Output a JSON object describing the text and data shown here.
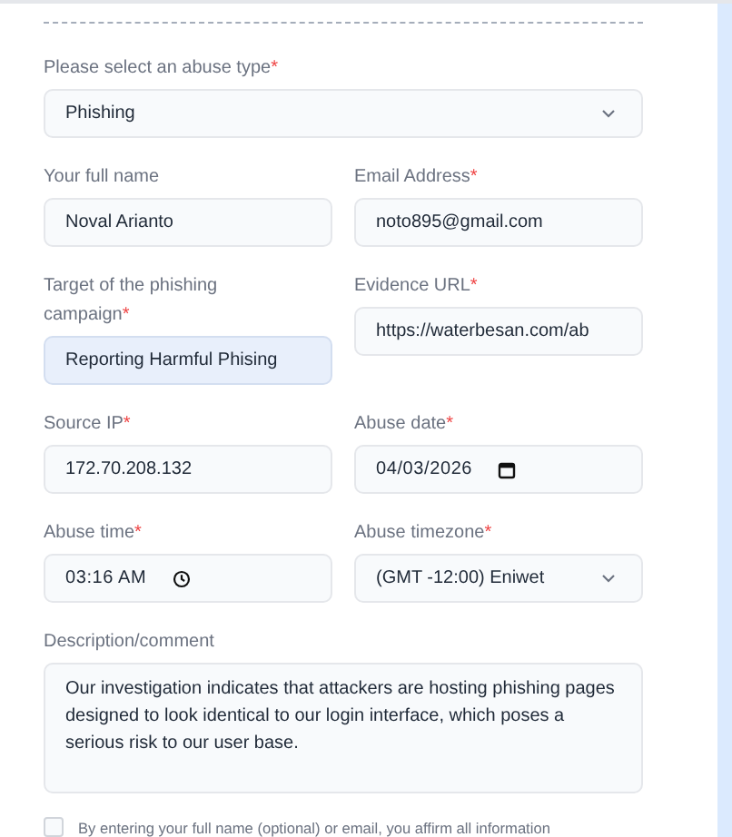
{
  "abuse_type": {
    "label": "Please select an abuse type",
    "required_marker": "*",
    "kind": "select",
    "value": "Phishing",
    "focused": false
  },
  "rows": [
    [
      {
        "label": "Your full name",
        "kind": "text",
        "value": "Noval Arianto",
        "focused": false
      },
      {
        "label": "Email Address",
        "required_marker": "*",
        "kind": "text",
        "value": "noto895@gmail.com",
        "focused": false
      }
    ],
    [
      {
        "label": "Target of the phishing campaign",
        "required_marker": "*",
        "kind": "text",
        "value": "Reporting Harmful Phising",
        "focused": true
      },
      {
        "label": "Evidence URL",
        "required_marker": "*",
        "kind": "text",
        "value": "https://waterbesan.com/ab",
        "focused": false
      }
    ],
    [
      {
        "label": "Source IP",
        "required_marker": "*",
        "kind": "text",
        "value": "172.70.208.132",
        "focused": false
      },
      {
        "label": "Abuse date",
        "required_marker": "*",
        "kind": "date",
        "value": "04/03/2026",
        "focused": false
      }
    ],
    [
      {
        "label": "Abuse time",
        "required_marker": "*",
        "kind": "time",
        "value": "03:16 AM",
        "focused": false
      },
      {
        "label": "Abuse timezone",
        "required_marker": "*",
        "kind": "select",
        "value": "(GMT -12:00) Eniwet",
        "focused": false
      }
    ]
  ],
  "description": {
    "label": "Description/comment",
    "kind": "textarea",
    "value": "Our investigation indicates that attackers are hosting phishing pages designed to look identical to our login interface, which poses a serious risk to our user base.",
    "focused": false
  },
  "consent": {
    "checked": false,
    "text": "By entering your full name (optional) or email, you affirm all information"
  }
}
